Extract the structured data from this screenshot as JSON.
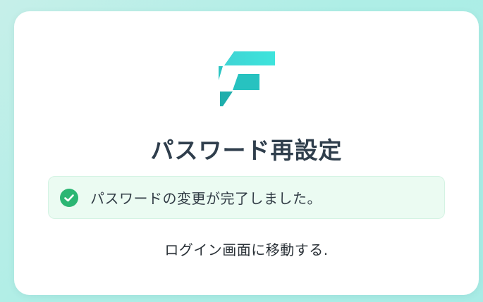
{
  "page": {
    "title": "パスワード再設定",
    "logo_icon": "brand-logo-icon",
    "accent_color": "#26c6c6"
  },
  "alert": {
    "icon": "check-circle-icon",
    "status_color": "#2bb673",
    "message": "パスワードの変更が完了しました。"
  },
  "login_link": {
    "label": "ログイン画面に移動する."
  }
}
